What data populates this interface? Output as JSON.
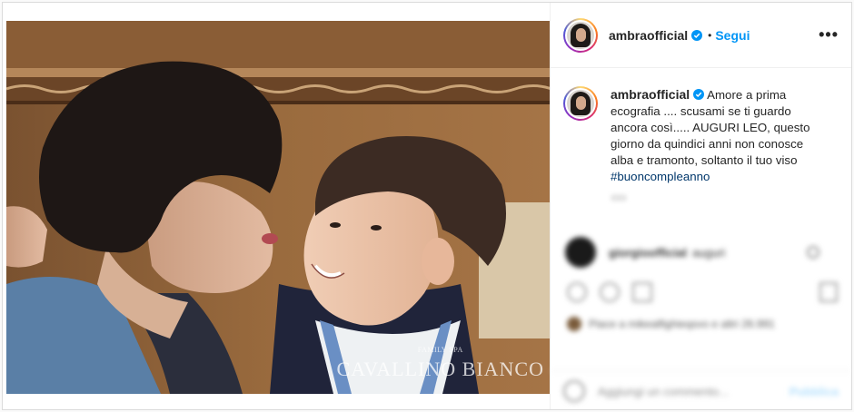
{
  "post": {
    "username": "ambraofficial",
    "follow_label": "Segui",
    "separator": "•",
    "more_label": "•••"
  },
  "caption": {
    "username": "ambraofficial",
    "text": "Amore a prima ecografia .... scusami se ti guardo ancora così..... AUGURI LEO, questo giorno da quindici anni non conosce alba e tramonto, soltanto il tuo viso",
    "hashtag": "#buoncompleanno"
  },
  "photo": {
    "watermark_small": "FAMILY SPA",
    "watermark_big": "CAVALLINO BIANCO"
  },
  "blurred_section": {
    "comment_user": "giorgioofficial",
    "comment_text": "auguri",
    "likes_text": "Piace a mikealfighieqsvo e altri 26.991",
    "add_comment_placeholder": "Aggiungi un commento...",
    "publish_label": "Pubblica"
  },
  "colors": {
    "accent": "#0095f6",
    "hashtag": "#00376b",
    "text": "#262626"
  }
}
